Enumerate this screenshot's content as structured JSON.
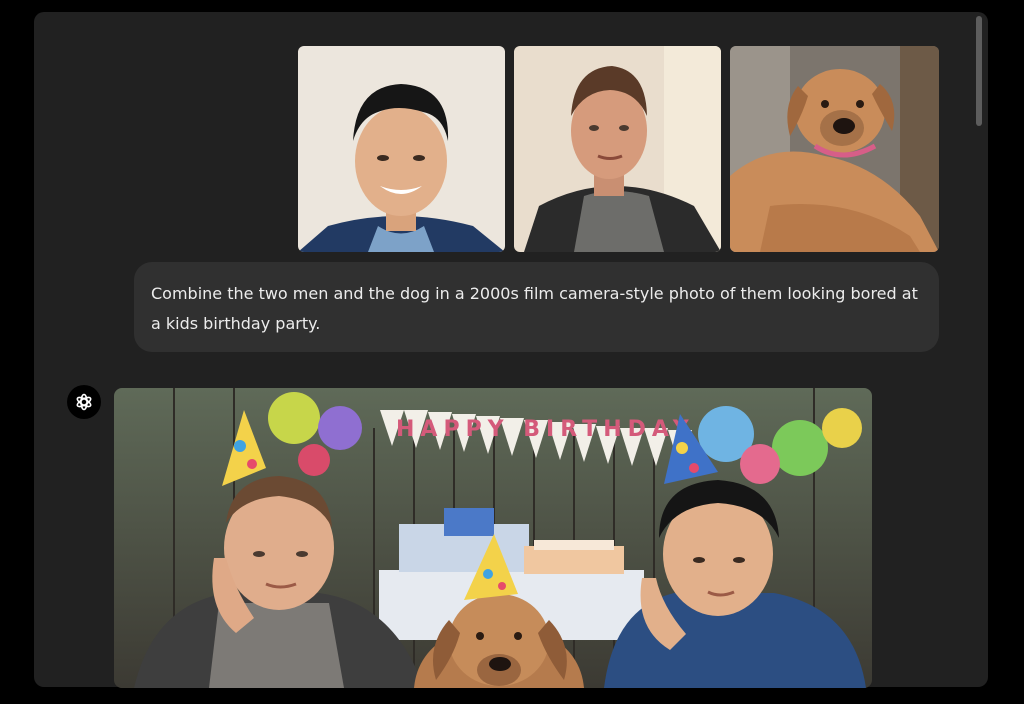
{
  "conversation": {
    "user_message": {
      "attachments": [
        {
          "name": "photo-man-1",
          "icon": "photo-thumbnail"
        },
        {
          "name": "photo-man-2",
          "icon": "photo-thumbnail"
        },
        {
          "name": "photo-dog",
          "icon": "photo-thumbnail"
        }
      ],
      "text": "Combine the two men and the dog in a 2000s film camera-style photo of them looking bored at a kids birthday party."
    },
    "assistant_message": {
      "avatar_icon": "openai-logo-icon",
      "image": {
        "banner_text": "HAPPY BIRTHDAY"
      }
    }
  },
  "colors": {
    "background": "#000000",
    "panel": "#212121",
    "bubble": "#303030",
    "text": "#ececec"
  }
}
